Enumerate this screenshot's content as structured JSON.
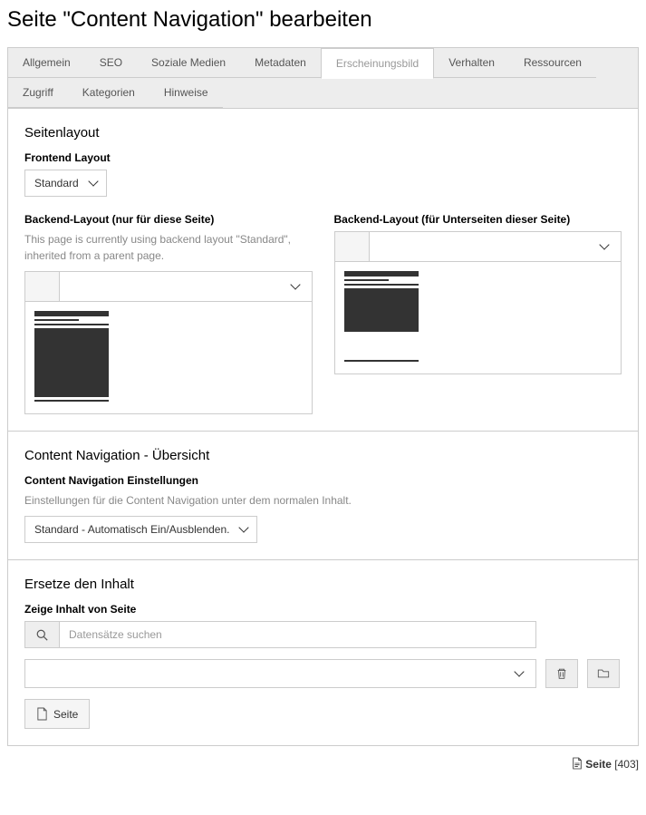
{
  "page_title": "Seite \"Content Navigation\" bearbeiten",
  "tabs": {
    "allgemein": "Allgemein",
    "seo": "SEO",
    "soziale_medien": "Soziale Medien",
    "metadaten": "Metadaten",
    "erscheinungsbild": "Erscheinungsbild",
    "verhalten": "Verhalten",
    "ressourcen": "Ressourcen",
    "zugriff": "Zugriff",
    "kategorien": "Kategorien",
    "hinweise": "Hinweise"
  },
  "layout": {
    "section_title": "Seitenlayout",
    "frontend_label": "Frontend Layout",
    "frontend_value": "Standard",
    "backend_this_label": "Backend-Layout (nur für diese Seite)",
    "backend_this_help": "This page is currently using backend layout \"Standard\", inherited from a parent page.",
    "backend_sub_label": "Backend-Layout (für Unterseiten dieser Seite)"
  },
  "contentnav": {
    "section_title": "Content Navigation - Übersicht",
    "settings_label": "Content Navigation Einstellungen",
    "settings_help": "Einstellungen für die Content Navigation unter dem normalen Inhalt.",
    "settings_value": "Standard - Automatisch Ein/Ausblenden."
  },
  "replace": {
    "section_title": "Ersetze den Inhalt",
    "show_label": "Zeige Inhalt von Seite",
    "search_placeholder": "Datensätze suchen",
    "page_btn": "Seite"
  },
  "footer": {
    "type": "Seite",
    "id": "[403]"
  }
}
